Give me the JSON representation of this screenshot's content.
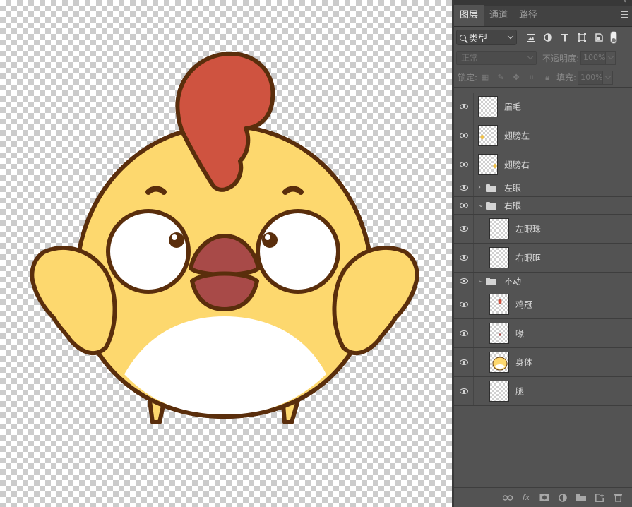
{
  "panel": {
    "tabs": [
      "图层",
      "通道",
      "路径"
    ],
    "active_tab": 0,
    "filter": {
      "selected": "类型"
    },
    "filter_icons": [
      "image-filter-icon",
      "adjustment-filter-icon",
      "type-filter-icon",
      "shape-filter-icon",
      "smart-object-filter-icon",
      "filter-toggle-icon"
    ],
    "blend": {
      "mode": "正常",
      "opacity_label": "不透明度:",
      "opacity_value": "100%"
    },
    "lock": {
      "label": "锁定:",
      "fill_label": "填充:",
      "fill_value": "100%"
    },
    "layers": [
      {
        "name": "眉毛",
        "type": "layer",
        "indent": 0,
        "thumb": "empty"
      },
      {
        "name": "翅膀左",
        "type": "layer",
        "indent": 0,
        "thumb": "wing-left"
      },
      {
        "name": "翅膀右",
        "type": "layer",
        "indent": 0,
        "thumb": "wing-right"
      },
      {
        "name": "左眼",
        "type": "group",
        "indent": 0,
        "expanded": false
      },
      {
        "name": "右眼",
        "type": "group",
        "indent": 0,
        "expanded": true
      },
      {
        "name": "左眼珠",
        "type": "layer",
        "indent": 1,
        "thumb": "empty"
      },
      {
        "name": "右眼眶",
        "type": "layer",
        "indent": 1,
        "thumb": "empty"
      },
      {
        "name": "不动",
        "type": "group",
        "indent": 0,
        "expanded": true
      },
      {
        "name": "鸡冠",
        "type": "layer",
        "indent": 1,
        "thumb": "comb"
      },
      {
        "name": "喙",
        "type": "layer",
        "indent": 1,
        "thumb": "beak"
      },
      {
        "name": "身体",
        "type": "layer",
        "indent": 1,
        "thumb": "body"
      },
      {
        "name": "腿",
        "type": "layer",
        "indent": 1,
        "thumb": "empty"
      }
    ],
    "bottom_icons": [
      "link-layers-icon",
      "fx-icon",
      "add-mask-icon",
      "adjustment-layer-icon",
      "new-group-icon",
      "new-layer-icon",
      "delete-layer-icon"
    ],
    "fx_label": "fx"
  },
  "colors": {
    "body": "#fdd86e",
    "outline": "#5a2e0c",
    "comb": "#cf5340",
    "beak": "#a84a48",
    "belly": "#ffffff"
  }
}
